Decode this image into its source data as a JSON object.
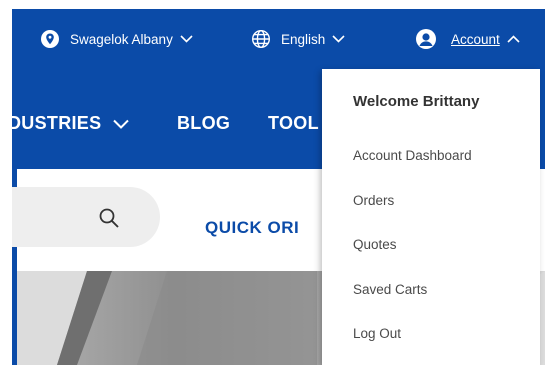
{
  "colors": {
    "brand_blue": "#0b4ba8",
    "menu_bg": "#ffffff",
    "search_bg": "#eeeeee"
  },
  "utility_bar": {
    "location": {
      "icon": "location-pin-icon",
      "label": "Swagelok Albany"
    },
    "language": {
      "icon": "globe-icon",
      "label": "English"
    },
    "account": {
      "icon": "user-icon",
      "label": "Account"
    }
  },
  "nav": {
    "industries": "DUSTRIES",
    "blog": "BLOG",
    "tools": "TOOL"
  },
  "header": {
    "search_icon": "search-icon",
    "quick_order": "QUICK ORI"
  },
  "account_menu": {
    "welcome": "Welcome Brittany",
    "items": [
      "Account Dashboard",
      "Orders",
      "Quotes",
      "Saved Carts",
      "Log Out"
    ]
  }
}
